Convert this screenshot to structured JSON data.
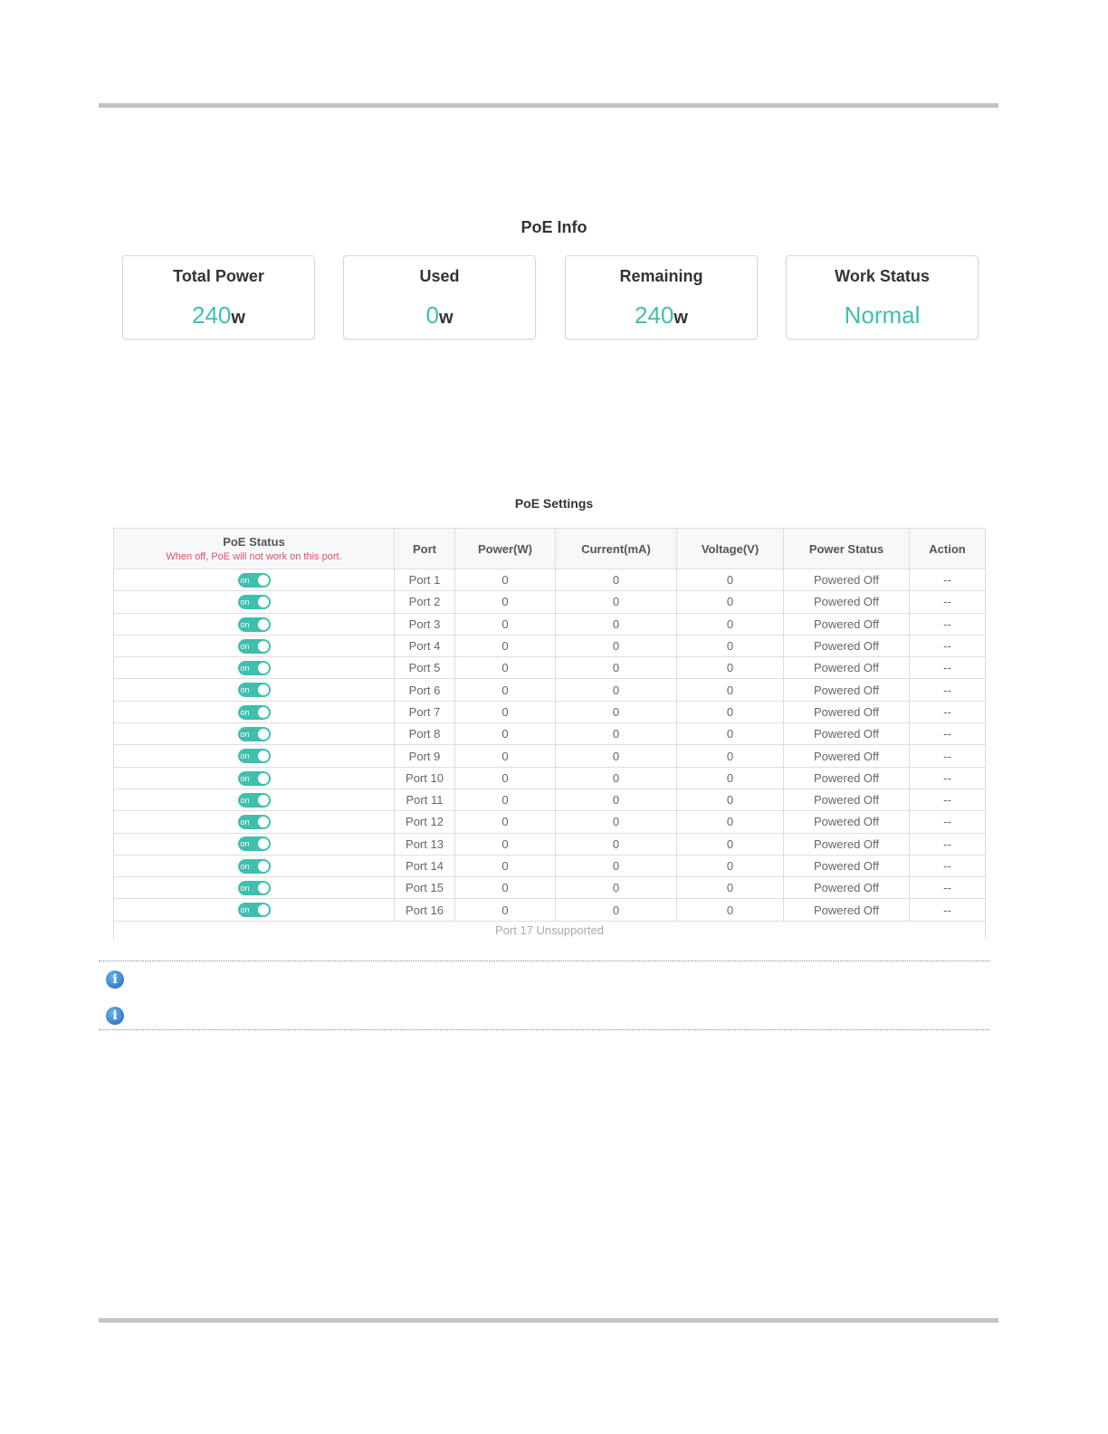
{
  "info": {
    "title": "PoE Info",
    "cards": [
      {
        "label": "Total Power",
        "value": "240",
        "unit": "w"
      },
      {
        "label": "Used",
        "value": "0",
        "unit": "w"
      },
      {
        "label": "Remaining",
        "value": "240",
        "unit": "w"
      },
      {
        "label": "Work Status",
        "value": "Normal",
        "unit": ""
      }
    ]
  },
  "settings": {
    "title": "PoE Settings",
    "headers": {
      "poe_status": "PoE Status",
      "poe_status_note": "When off, PoE will not work on this port.",
      "port": "Port",
      "power": "Power(W)",
      "current": "Current(mA)",
      "voltage": "Voltage(V)",
      "power_status": "Power Status",
      "action": "Action"
    },
    "toggle_label": "on",
    "rows": [
      {
        "port": "Port 1",
        "power": "0",
        "current": "0",
        "voltage": "0",
        "status": "Powered Off",
        "action": "--"
      },
      {
        "port": "Port 2",
        "power": "0",
        "current": "0",
        "voltage": "0",
        "status": "Powered Off",
        "action": "--"
      },
      {
        "port": "Port 3",
        "power": "0",
        "current": "0",
        "voltage": "0",
        "status": "Powered Off",
        "action": "--"
      },
      {
        "port": "Port 4",
        "power": "0",
        "current": "0",
        "voltage": "0",
        "status": "Powered Off",
        "action": "--"
      },
      {
        "port": "Port 5",
        "power": "0",
        "current": "0",
        "voltage": "0",
        "status": "Powered Off",
        "action": "--"
      },
      {
        "port": "Port 6",
        "power": "0",
        "current": "0",
        "voltage": "0",
        "status": "Powered Off",
        "action": "--"
      },
      {
        "port": "Port 7",
        "power": "0",
        "current": "0",
        "voltage": "0",
        "status": "Powered Off",
        "action": "--"
      },
      {
        "port": "Port 8",
        "power": "0",
        "current": "0",
        "voltage": "0",
        "status": "Powered Off",
        "action": "--"
      },
      {
        "port": "Port 9",
        "power": "0",
        "current": "0",
        "voltage": "0",
        "status": "Powered Off",
        "action": "--"
      },
      {
        "port": "Port 10",
        "power": "0",
        "current": "0",
        "voltage": "0",
        "status": "Powered Off",
        "action": "--"
      },
      {
        "port": "Port 11",
        "power": "0",
        "current": "0",
        "voltage": "0",
        "status": "Powered Off",
        "action": "--"
      },
      {
        "port": "Port 12",
        "power": "0",
        "current": "0",
        "voltage": "0",
        "status": "Powered Off",
        "action": "--"
      },
      {
        "port": "Port 13",
        "power": "0",
        "current": "0",
        "voltage": "0",
        "status": "Powered Off",
        "action": "--"
      },
      {
        "port": "Port 14",
        "power": "0",
        "current": "0",
        "voltage": "0",
        "status": "Powered Off",
        "action": "--"
      },
      {
        "port": "Port 15",
        "power": "0",
        "current": "0",
        "voltage": "0",
        "status": "Powered Off",
        "action": "--"
      },
      {
        "port": "Port 16",
        "power": "0",
        "current": "0",
        "voltage": "0",
        "status": "Powered Off",
        "action": "--"
      }
    ],
    "footer": "Port 17 Unsupported"
  },
  "notes": {
    "icons": [
      "info-icon",
      "info-icon"
    ],
    "accent_color": "#3fbfae",
    "note_color": "#e0506a"
  }
}
